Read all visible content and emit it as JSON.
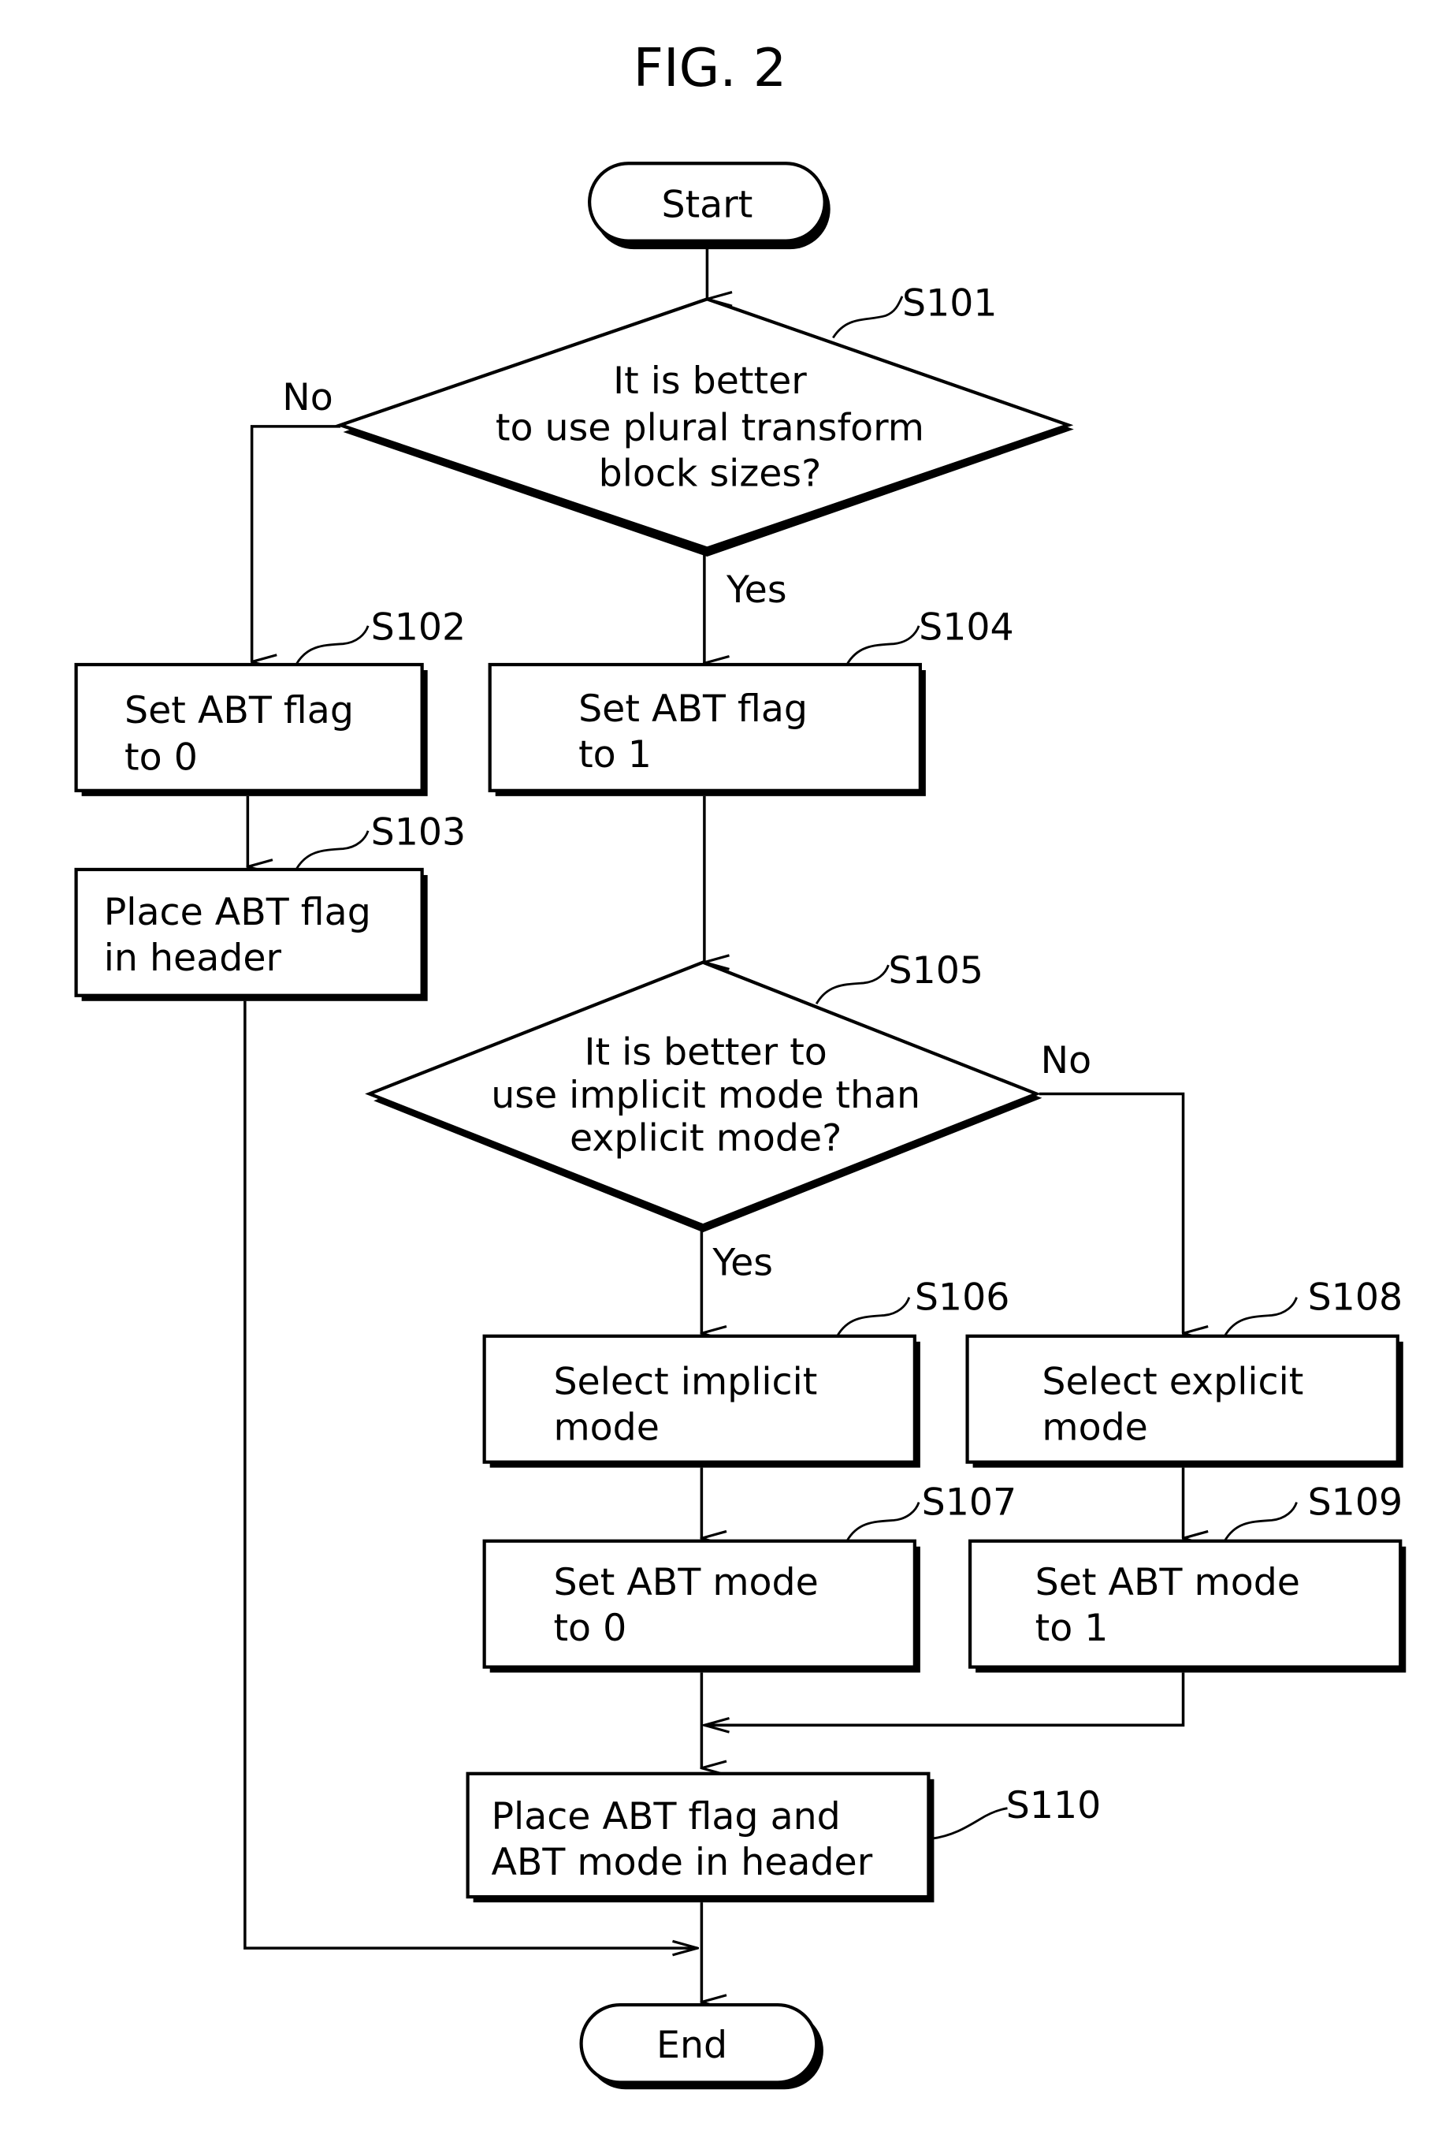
{
  "figure": {
    "title": "FIG. 2",
    "start_label": "Start",
    "end_label": "End"
  },
  "nodes": {
    "s101": {
      "step": "S101",
      "type": "decision",
      "lines": [
        "It is better",
        "to use plural transform",
        "block sizes?"
      ]
    },
    "s102": {
      "step": "S102",
      "type": "process",
      "lines": [
        "Set ABT flag",
        "to 0"
      ]
    },
    "s103": {
      "step": "S103",
      "type": "process",
      "lines": [
        "Place ABT flag",
        "in header"
      ]
    },
    "s104": {
      "step": "S104",
      "type": "process",
      "lines": [
        "Set ABT flag",
        "to 1"
      ]
    },
    "s105": {
      "step": "S105",
      "type": "decision",
      "lines": [
        "It is better to",
        "use implicit mode than",
        "explicit mode?"
      ]
    },
    "s106": {
      "step": "S106",
      "type": "process",
      "lines": [
        "Select implicit",
        "mode"
      ]
    },
    "s107": {
      "step": "S107",
      "type": "process",
      "lines": [
        "Set ABT mode",
        "to 0"
      ]
    },
    "s108": {
      "step": "S108",
      "type": "process",
      "lines": [
        "Select explicit",
        "mode"
      ]
    },
    "s109": {
      "step": "S109",
      "type": "process",
      "lines": [
        "Set ABT mode",
        "to 1"
      ]
    },
    "s110": {
      "step": "S110",
      "type": "process",
      "lines": [
        "Place ABT flag and",
        "ABT mode in header"
      ]
    }
  },
  "edges": {
    "s101_no": "No",
    "s101_yes": "Yes",
    "s105_no": "No",
    "s105_yes": "Yes"
  }
}
